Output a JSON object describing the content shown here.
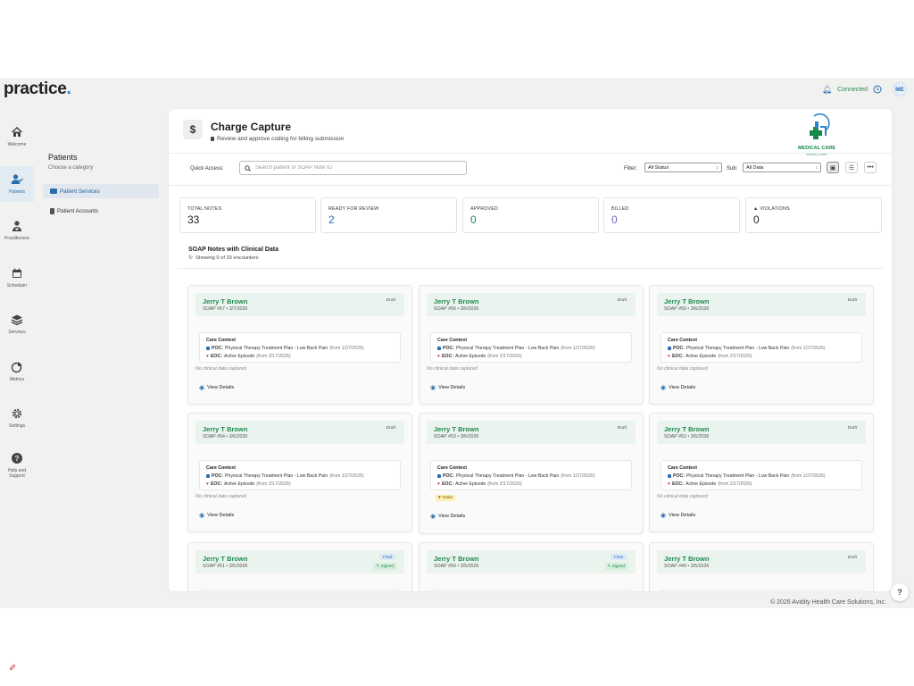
{
  "app": {
    "logo": "practice",
    "logo_dot": "."
  },
  "topbar": {
    "status": "Connected",
    "user_initials": "ME"
  },
  "nav": [
    {
      "label": "Welcome",
      "icon": "home-icon"
    },
    {
      "label": "Patients",
      "icon": "patients-icon"
    },
    {
      "label": "Practitioners",
      "icon": "practitioners-icon"
    },
    {
      "label": "Scheduler",
      "icon": "calendar-icon"
    },
    {
      "label": "Services",
      "icon": "layers-icon"
    },
    {
      "label": "Metrics",
      "icon": "pie-chart-icon"
    },
    {
      "label": "Settings",
      "icon": "gear-icon"
    },
    {
      "label": "Help and Support",
      "icon": "help-icon"
    }
  ],
  "category": {
    "title": "Patients",
    "subtitle": "Choose a category",
    "items": [
      "Patient Services",
      "Patient Accounts"
    ]
  },
  "header": {
    "title": "Charge Capture",
    "subtitle": "Review and approve coding for billing submission",
    "brand_name": "MEDICAL CARE",
    "brand_sub": "Medical Center"
  },
  "toolbar": {
    "quick_access_label": "Quick Access:",
    "search_placeholder": "Search patient or SOAP Note ID",
    "filter_label": "Filter:",
    "filter_value": "All Status",
    "sub_label": "Sub:",
    "sub_value": "All Data"
  },
  "stats": [
    {
      "label": "TOTAL NOTES",
      "value": "33",
      "color": "#222222"
    },
    {
      "label": "READY FOR REVIEW",
      "value": "2",
      "color": "#2a6cb0"
    },
    {
      "label": "APPROVED",
      "value": "0",
      "color": "#1e8a4f"
    },
    {
      "label": "BILLED",
      "value": "0",
      "color": "#7a5cb8"
    },
    {
      "label": "VIOLATIONS",
      "value": "0",
      "color": "#222222"
    }
  ],
  "section": {
    "title": "SOAP Notes with Clinical Data",
    "subtitle": "Showing 9 of 33 encounters"
  },
  "card_common": {
    "context_title": "Care Context",
    "poc_label": "POC:",
    "poc_text": "Physical Therapy Treatment Plan - Low Back Pain",
    "poc_from": "(from 1/27/2026)",
    "eoc_label": "EOC:",
    "eoc_text": "Active Episode",
    "eoc_from": "(from 2/17/2026)",
    "no_clinical": "No clinical data captured",
    "vitals": "Vitals",
    "view_details": "View Details"
  },
  "cards": [
    {
      "name": "Jerry T Brown",
      "sub": "SOAP #57 • 3/7/2026",
      "status": "Draft"
    },
    {
      "name": "Jerry T Brown",
      "sub": "SOAP #56 • 3/6/2026",
      "status": "Draft"
    },
    {
      "name": "Jerry T Brown",
      "sub": "SOAP #55 • 3/6/2026",
      "status": "Draft"
    },
    {
      "name": "Jerry T Brown",
      "sub": "SOAP #54 • 3/6/2026",
      "status": "Draft"
    },
    {
      "name": "Jerry T Brown",
      "sub": "SOAP #53 • 3/6/2026",
      "status": "Draft"
    },
    {
      "name": "Jerry T Brown",
      "sub": "SOAP #52 • 3/6/2026",
      "status": "Draft"
    },
    {
      "name": "Jerry T Brown",
      "sub": "SOAP #51 • 3/5/2026",
      "status": "Final",
      "signed": "Signed"
    },
    {
      "name": "Jerry T Brown",
      "sub": "SOAP #50 • 3/5/2026",
      "status": "Final",
      "signed": "Signed"
    },
    {
      "name": "Jerry T Brown",
      "sub": "SOAP #49 • 3/5/2026",
      "status": "Draft"
    }
  ],
  "footer": {
    "copyright": "© 2026 Avidity Health Care Solutions, Inc."
  }
}
